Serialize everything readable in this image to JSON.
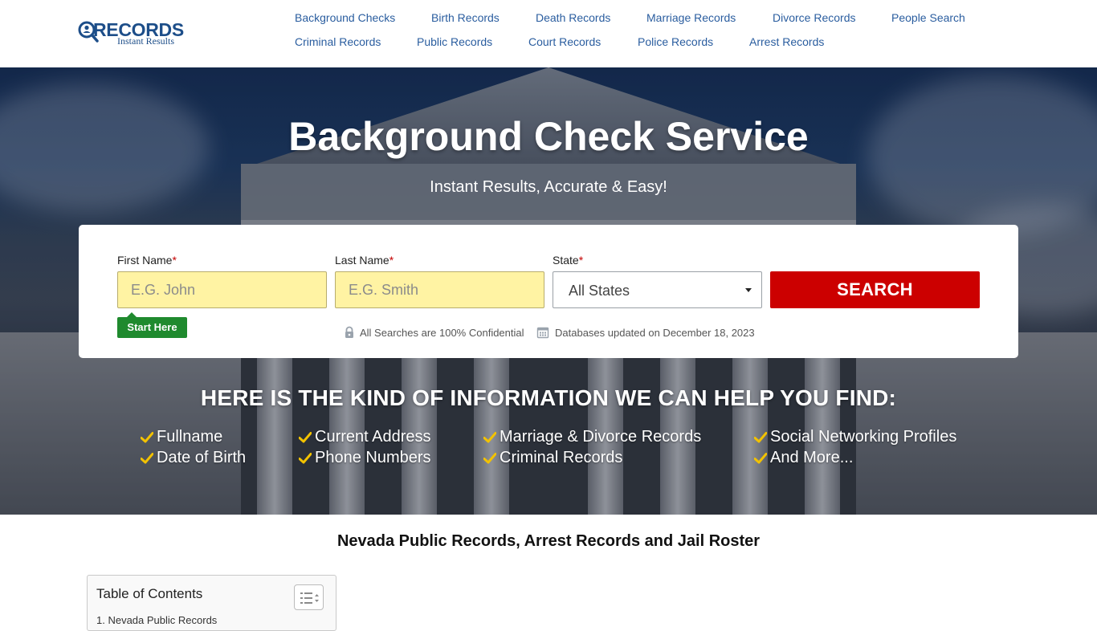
{
  "brand": {
    "logo_word": "RECORDS",
    "logo_sub": "Instant Results",
    "color": "#1d4e89"
  },
  "nav": {
    "row1": [
      "Background Checks",
      "Birth Records",
      "Death Records",
      "Marriage Records",
      "Divorce Records",
      "People Search"
    ],
    "row2": [
      "Criminal Records",
      "Public Records",
      "Court Records",
      "Police Records",
      "Arrest Records"
    ]
  },
  "hero": {
    "title": "Background Check Service",
    "subtitle": "Instant Results, Accurate & Easy!"
  },
  "search": {
    "first_name_label": "First Name",
    "last_name_label": "Last Name",
    "state_label": "State",
    "required_mark": "*",
    "first_name_placeholder": "E.G. John",
    "last_name_placeholder": "E.G. Smith",
    "state_value": "All States",
    "button_label": "SEARCH",
    "start_here": "Start Here",
    "confidential_note": "All Searches are 100% Confidential",
    "updated_note": "Databases updated on December 18, 2023",
    "button_color": "#cc0000",
    "input_color": "#fff3a3",
    "badge_color": "#1f8a2e"
  },
  "info": {
    "title": "HERE IS THE KIND OF INFORMATION WE CAN HELP YOU FIND:",
    "columns": [
      [
        "Fullname",
        "Date of Birth"
      ],
      [
        "Current Address",
        "Phone Numbers"
      ],
      [
        "Marriage & Divorce Records",
        "Criminal Records"
      ],
      [
        "Social Networking Profiles",
        "And More..."
      ]
    ],
    "check_icon": "check-icon",
    "check_color": "#f2c200"
  },
  "content": {
    "page_title": "Nevada Public Records, Arrest Records and Jail Roster",
    "toc_title": "Table of Contents",
    "toc_first_item": "1. Nevada Public Records"
  }
}
